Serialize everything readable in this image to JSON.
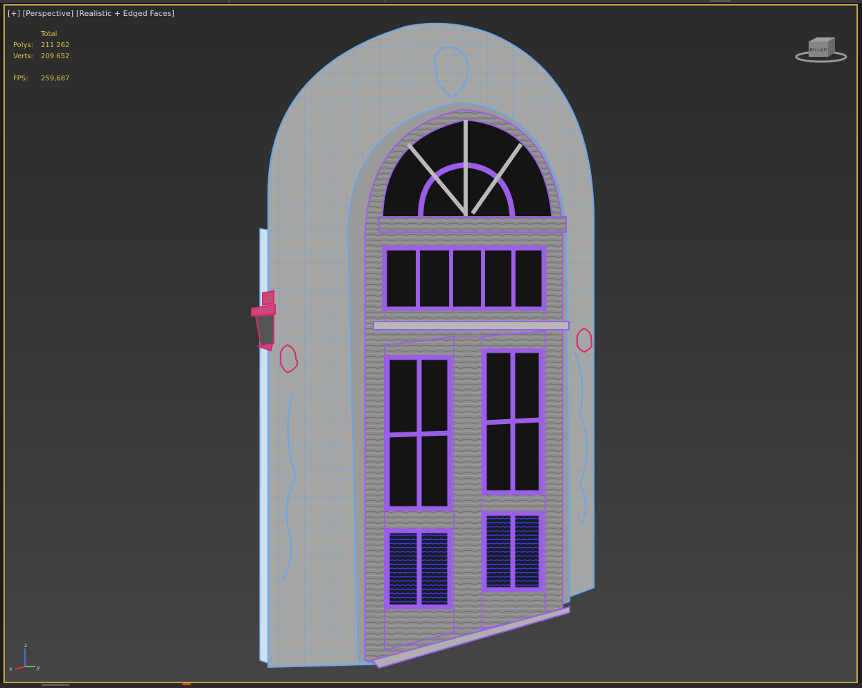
{
  "viewport": {
    "label_plus": "[+]",
    "label_view": "[Perspective]",
    "label_shading": "[Realistic + Edged Faces]"
  },
  "stats": {
    "header": "Total",
    "polys_label": "Polys:",
    "polys_value": "211 262",
    "verts_label": "Verts:",
    "verts_value": "209 652",
    "fps_label": "FPS:",
    "fps_value": "259,687"
  },
  "viewcube": {
    "face_label": "Bn  LAD"
  },
  "axis_tripod": {
    "x": "x",
    "y": "y",
    "z": "z"
  },
  "colors": {
    "frame_border": "#c8a247",
    "stats_text": "#e2c24a",
    "wire_wall": "#6aa6e8",
    "wire_door": "#9a5ee8",
    "wire_lamp": "#d6286e",
    "wood": "#8a8a8a"
  }
}
